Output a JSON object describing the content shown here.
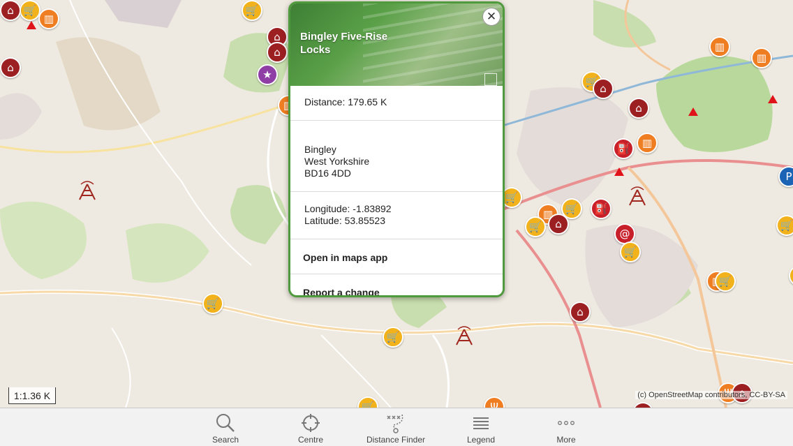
{
  "map": {
    "scale_label": "1:1.36 K",
    "attribution": "(c) OpenStreetMap contributors, CC-BY-SA",
    "colors": {
      "land": "#efeae1",
      "green": "#c8deae",
      "road": "#ffffff",
      "major_road": "#f4c79b"
    }
  },
  "popup": {
    "title": "Bingley Five-Rise Locks",
    "distance": "Distance: 179.65 K",
    "address_line1": "Bingley",
    "address_line2": "West Yorkshire",
    "address_line3": "BD16 4DD",
    "longitude": "Longitude: -1.83892",
    "latitude": "Latitude: 53.85523",
    "open_maps_label": "Open in maps app",
    "report_label": "Report a change"
  },
  "toolbar": {
    "items": [
      {
        "label": "Search",
        "icon": "search-icon"
      },
      {
        "label": "Centre",
        "icon": "crosshair-icon"
      },
      {
        "label": "Distance Finder",
        "icon": "distance-finder-icon"
      },
      {
        "label": "Legend",
        "icon": "list-icon"
      },
      {
        "label": "More",
        "icon": "more-dots-icon"
      }
    ]
  }
}
